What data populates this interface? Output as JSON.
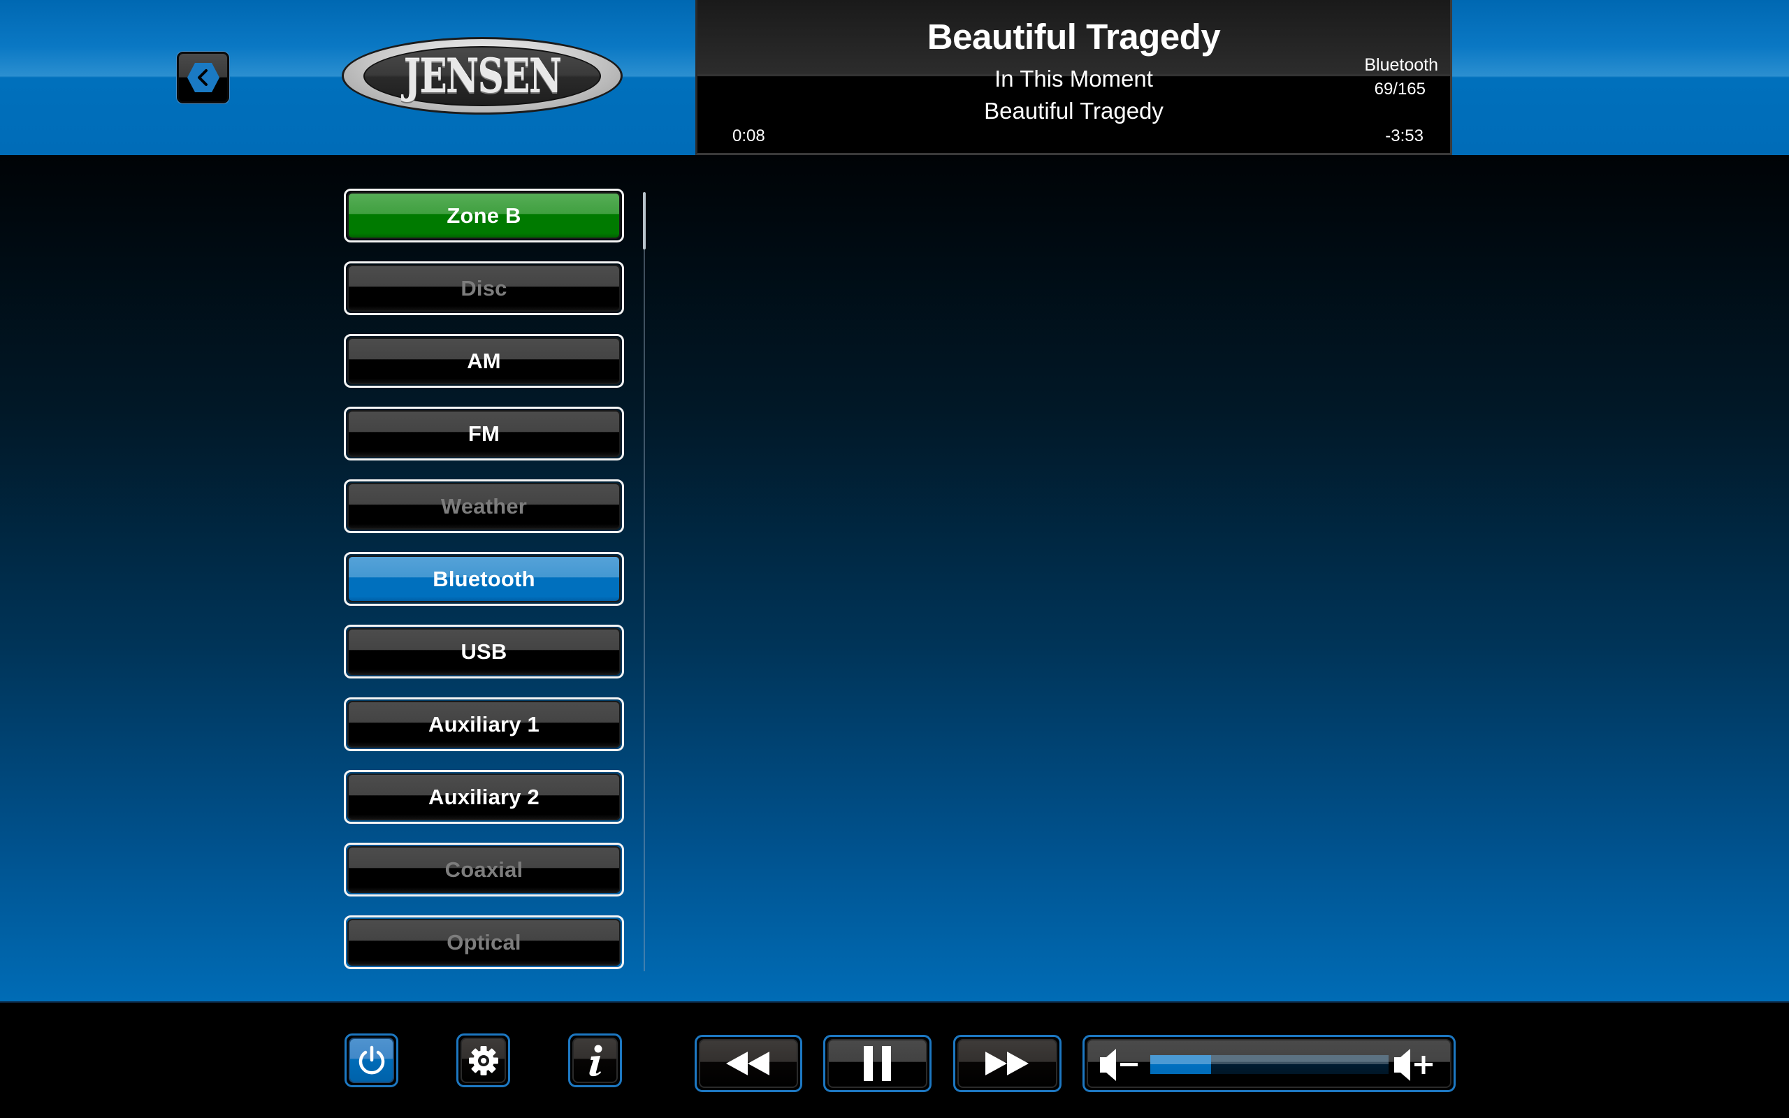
{
  "header": {
    "back_button_label": "Back",
    "logo_text": "JENSEN"
  },
  "now_playing": {
    "title": "Beautiful Tragedy",
    "artist": "In This Moment",
    "album": "Beautiful Tragedy",
    "source": "Bluetooth",
    "track_position": "69/165",
    "elapsed": "0:08",
    "remaining": "-3:53"
  },
  "sources": [
    {
      "label": "Zone B",
      "state": "zone"
    },
    {
      "label": "Disc",
      "state": "disabled"
    },
    {
      "label": "AM",
      "state": "normal"
    },
    {
      "label": "FM",
      "state": "normal"
    },
    {
      "label": "Weather",
      "state": "disabled"
    },
    {
      "label": "Bluetooth",
      "state": "active"
    },
    {
      "label": "USB",
      "state": "normal"
    },
    {
      "label": "Auxiliary 1",
      "state": "normal"
    },
    {
      "label": "Auxiliary 2",
      "state": "normal"
    },
    {
      "label": "Coaxial",
      "state": "disabled"
    },
    {
      "label": "Optical",
      "state": "disabled"
    }
  ],
  "footer": {
    "power_label": "Power",
    "settings_label": "Settings",
    "info_label": "Info",
    "rewind_label": "Rewind",
    "pause_label": "Pause",
    "fast_forward_label": "Fast Forward",
    "volume_down_label": "Volume Down",
    "volume_up_label": "Volume Up",
    "volume_level": 0.255
  },
  "colors": {
    "accent_blue": "#0070be",
    "zone_green": "#007a00",
    "disabled_text": "#7d7d7d"
  }
}
